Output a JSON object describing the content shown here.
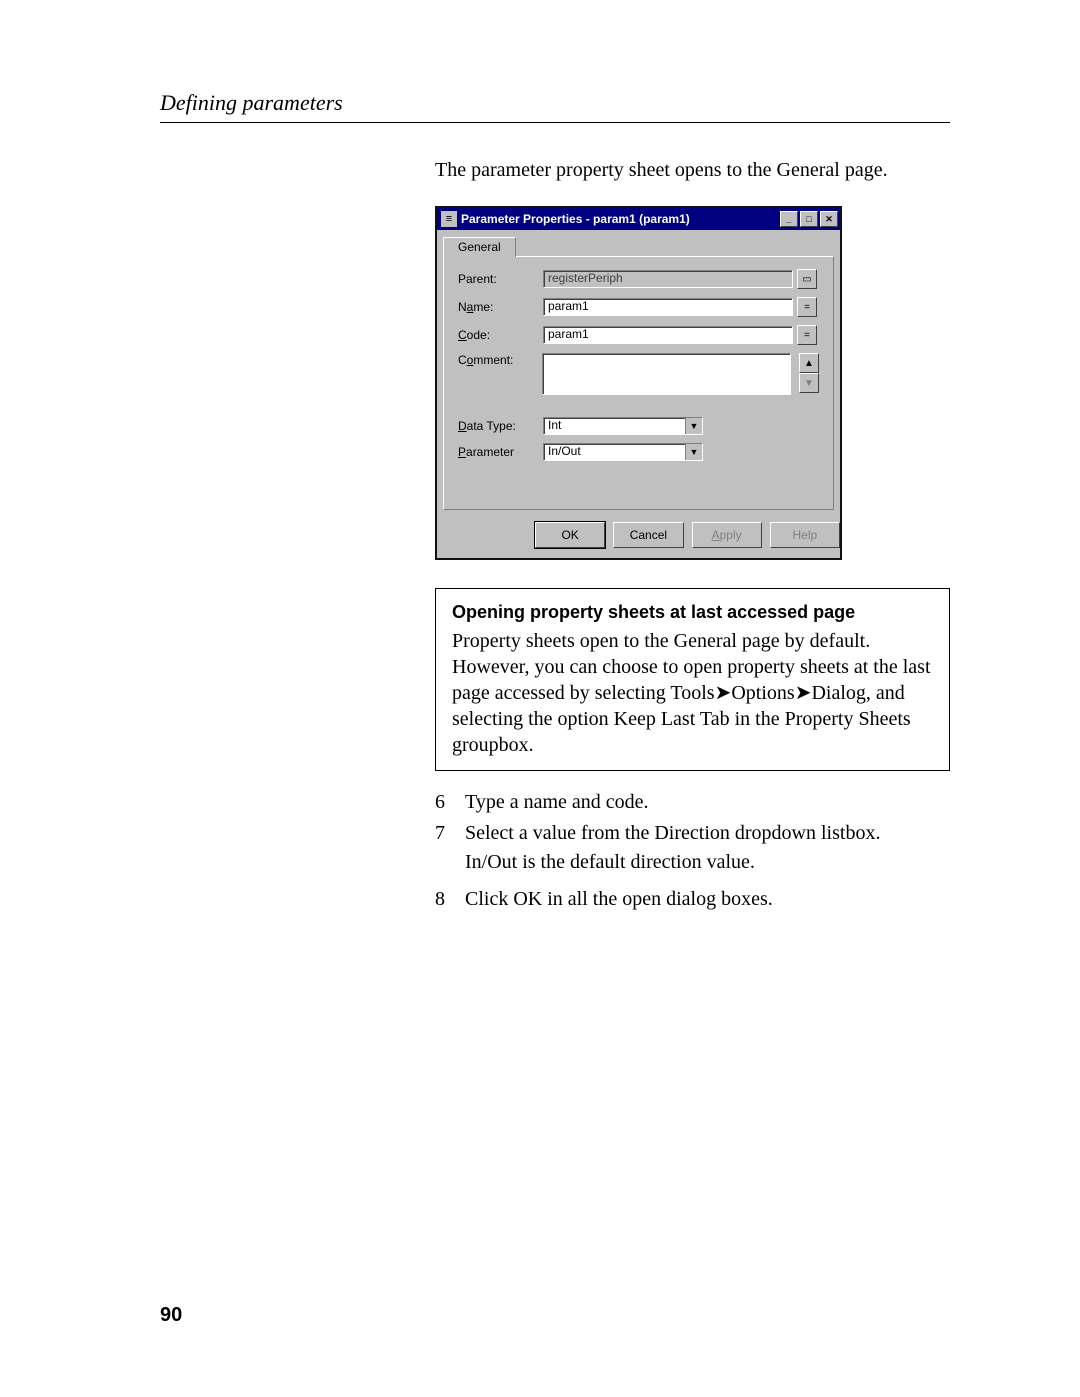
{
  "header": "Defining parameters",
  "intro": "The parameter property sheet opens to the General page.",
  "dialog": {
    "title": "Parameter Properties - param1 (param1)",
    "tab": "General",
    "labels": {
      "parent": "Parent:",
      "name_pre": "N",
      "name_u": "a",
      "name_post": "me:",
      "code_u": "C",
      "code_post": "ode:",
      "comment_pre": "C",
      "comment_u": "o",
      "comment_post": "mment:",
      "dtype_u": "D",
      "dtype_post": "ata Type:",
      "param_u": "P",
      "param_post": "arameter"
    },
    "fields": {
      "parent": "registerPeriph",
      "name": "param1",
      "code": "param1",
      "data_type": "Int",
      "parameter": "In/Out"
    },
    "buttons": {
      "ok": "OK",
      "cancel": "Cancel",
      "apply_u": "A",
      "apply_post": "pply",
      "help": "Help"
    }
  },
  "note": {
    "title": "Opening property sheets at last accessed page",
    "body_1": "Property sheets open to the General page by default. However, you can choose to open property sheets at the last page accessed by selecting Tools",
    "body_2": "Options",
    "body_3": "Dialog, and selecting the option Keep Last Tab in the Property Sheets groupbox."
  },
  "steps": {
    "s6": {
      "num": "6",
      "text": "Type a name and code."
    },
    "s7": {
      "num": "7",
      "text": "Select a value from the Direction dropdown listbox.",
      "sub": "In/Out is the default direction value."
    },
    "s8": {
      "num": "8",
      "text": "Click OK in all the open dialog boxes."
    }
  },
  "page_number": "90"
}
